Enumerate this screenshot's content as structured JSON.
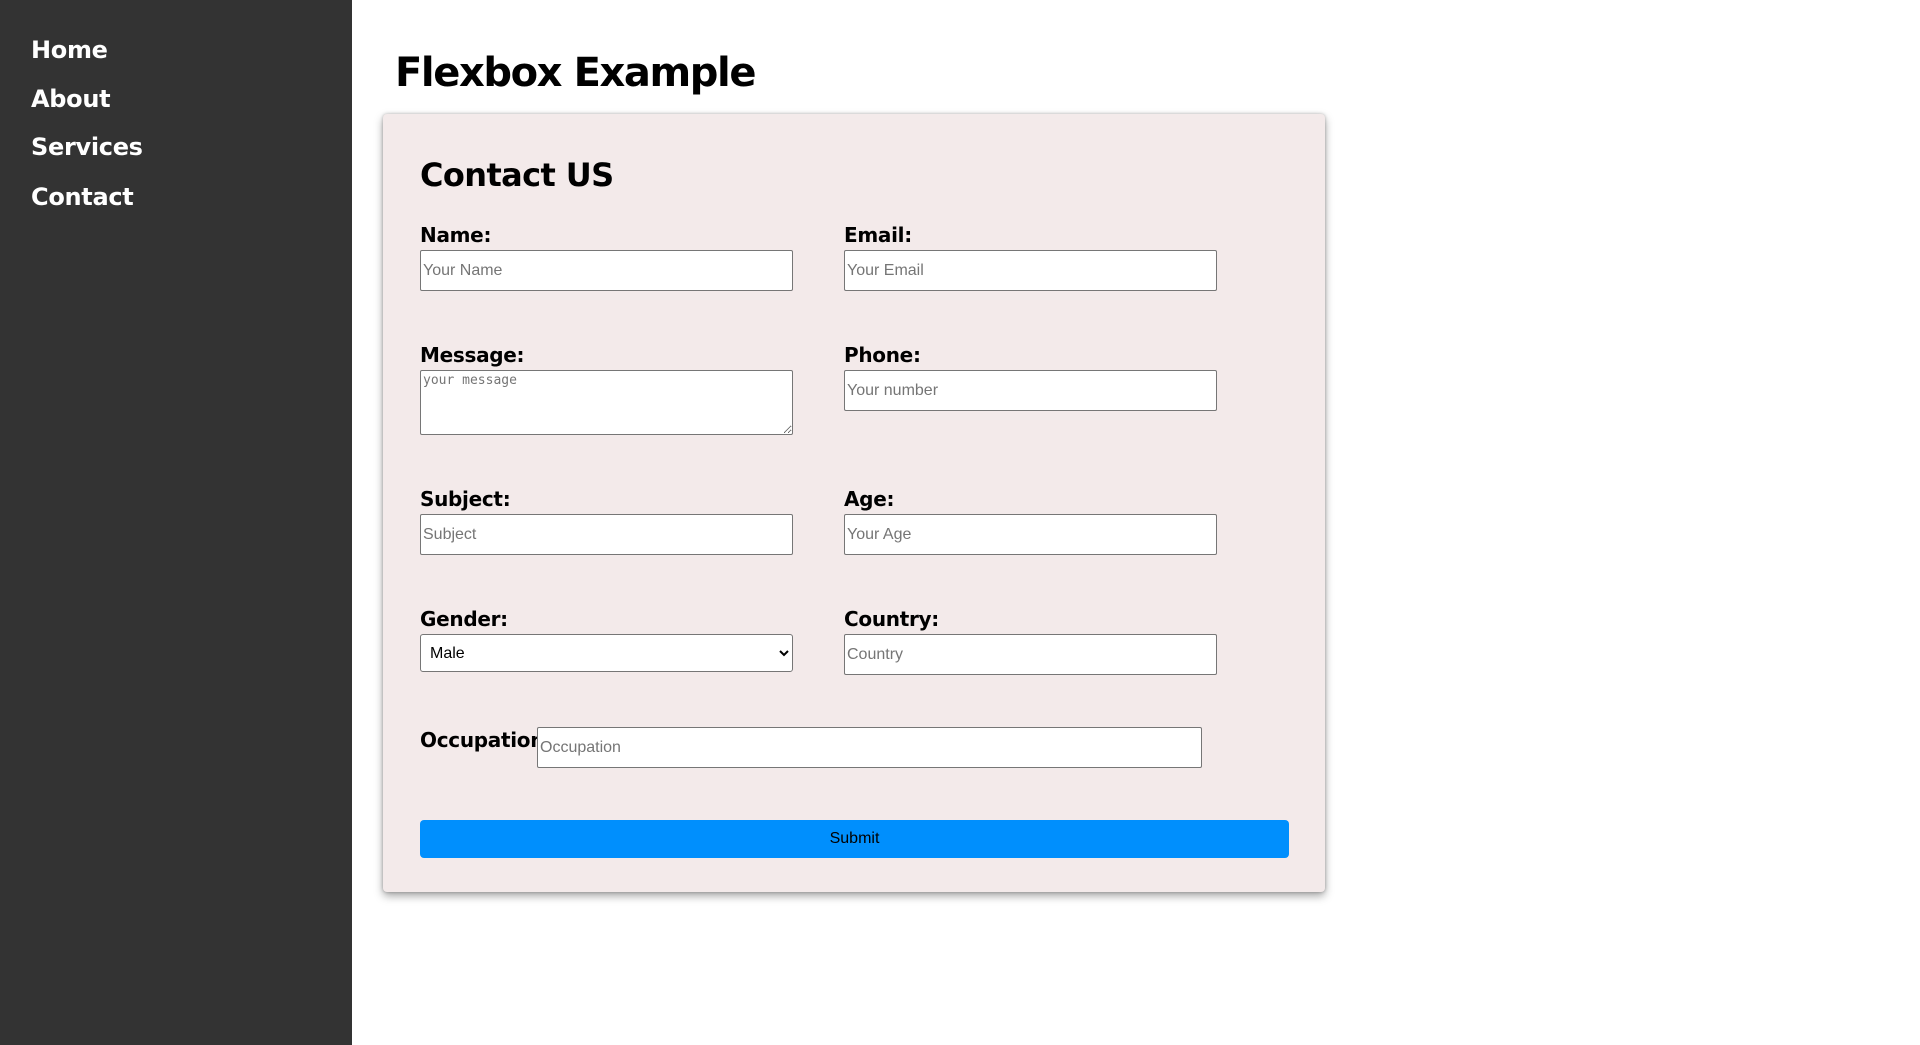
{
  "nav": {
    "items": [
      {
        "label": "Home"
      },
      {
        "label": "About"
      },
      {
        "label": "Services"
      },
      {
        "label": "Contact"
      }
    ]
  },
  "page": {
    "title": "Flexbox Example"
  },
  "form": {
    "title": "Contact US",
    "name": {
      "label": "Name:",
      "placeholder": "Your Name"
    },
    "email": {
      "label": "Email:",
      "placeholder": "Your Email"
    },
    "message": {
      "label": "Message:",
      "placeholder": "your message"
    },
    "phone": {
      "label": "Phone:",
      "placeholder": "Your number"
    },
    "subject": {
      "label": "Subject:",
      "placeholder": "Subject"
    },
    "age": {
      "label": "Age:",
      "placeholder": "Your Age"
    },
    "gender": {
      "label": "Gender:",
      "selected": "Male"
    },
    "country": {
      "label": "Country:",
      "placeholder": "Country"
    },
    "occupation": {
      "label": "Occupation:",
      "placeholder": "Occupation"
    },
    "submit_label": "Submit"
  },
  "colors": {
    "sidebar_bg": "#333333",
    "card_bg": "#f3eaea",
    "submit_bg": "#008ffd"
  }
}
